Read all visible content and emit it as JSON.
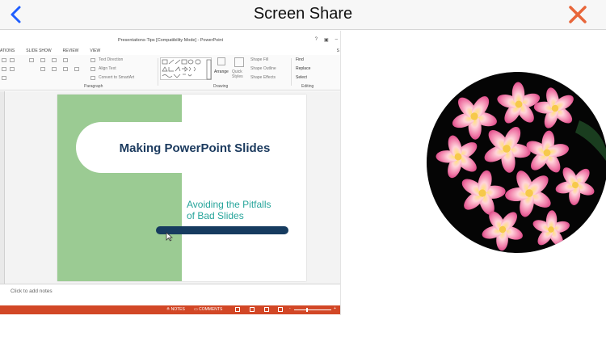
{
  "navbar": {
    "title": "Screen Share",
    "back_icon": "chevron-left-icon",
    "close_icon": "close-icon",
    "back_color": "#1f5eff",
    "close_color": "#e8663a"
  },
  "shared_screen": {
    "app": {
      "document_title": "Presentations-Tips [Compatibility Mode] - PowerPoint",
      "window_controls": [
        "?",
        "▣",
        "–"
      ]
    },
    "ribbon": {
      "tabs": [
        "ATIONS",
        "SLIDE SHOW",
        "REVIEW",
        "VIEW",
        "S"
      ],
      "paragraph": {
        "label": "Paragraph",
        "text_direction": "Text Direction",
        "align_text": "Align Text",
        "convert_to_smartart": "Convert to SmartArt"
      },
      "drawing": {
        "label": "Drawing",
        "arrange": "Arrange",
        "quick_styles": "Quick Styles",
        "shape_fill": "Shape Fill",
        "shape_outline": "Shape Outline",
        "shape_effects": "Shape Effects"
      },
      "editing": {
        "label": "Editing",
        "find": "Find",
        "replace": "Replace",
        "select": "Select"
      }
    },
    "slide": {
      "title": "Making PowerPoint Slides",
      "subtitle_line1": "Avoiding the Pitfalls",
      "subtitle_line2": "of Bad Slides",
      "colors": {
        "green_panel": "#9bcb93",
        "title": "#1b3a5e",
        "subtitle": "#27a59b",
        "bar": "#163b5f"
      }
    },
    "notes_placeholder": "Click to add notes",
    "status_bar": {
      "notes": "NOTES",
      "comments": "COMMENTS",
      "zoom_minus": "-",
      "zoom_plus": "+",
      "color": "#d24726"
    }
  },
  "camera": {
    "subject": "pink-plumeria-flowers"
  }
}
